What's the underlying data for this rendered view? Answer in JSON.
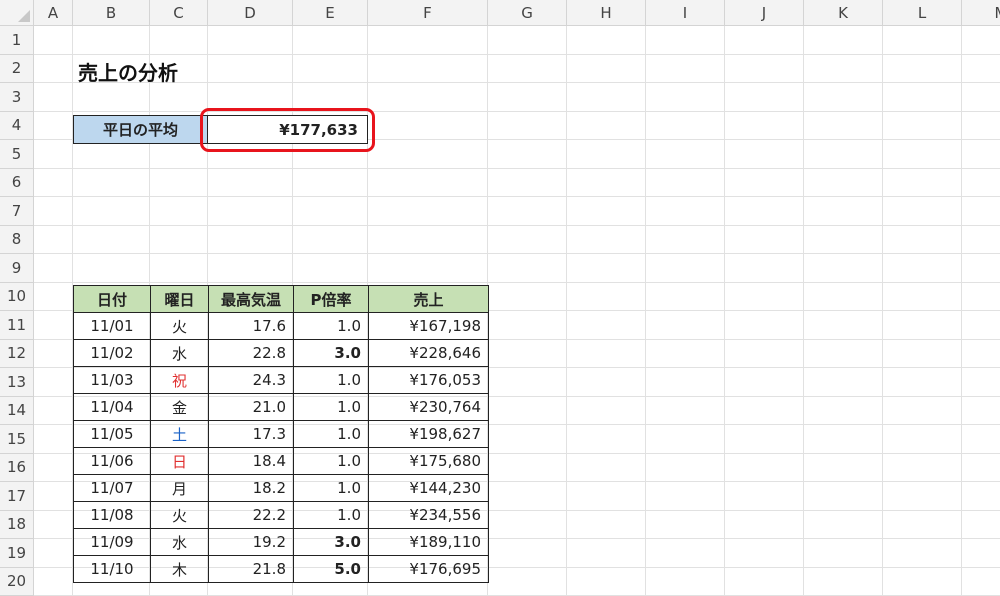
{
  "columns": [
    "A",
    "B",
    "C",
    "D",
    "E",
    "F",
    "G",
    "H",
    "I",
    "J",
    "K",
    "L",
    "M"
  ],
  "rows": [
    "1",
    "2",
    "3",
    "4",
    "5",
    "6",
    "7",
    "8",
    "9",
    "10",
    "11",
    "12",
    "13",
    "14",
    "15",
    "16",
    "17",
    "18",
    "19",
    "20"
  ],
  "sheet_title": "売上の分析",
  "summary": {
    "label": "平日の平均",
    "value": "¥177,633"
  },
  "colors": {
    "header_fill": "#c6e0b4",
    "label_fill": "#bdd7ee",
    "highlight": "#e8141c",
    "holiday": "#e03030",
    "saturday": "#1a62c7"
  },
  "table": {
    "headers": [
      "日付",
      "曜日",
      "最高気温",
      "P倍率",
      "売上"
    ],
    "rows": [
      {
        "date": "11/01",
        "day": "火",
        "temp": "17.6",
        "rate": "1.0",
        "sales": "¥167,198",
        "day_color": "",
        "rate_bold": false
      },
      {
        "date": "11/02",
        "day": "水",
        "temp": "22.8",
        "rate": "3.0",
        "sales": "¥228,646",
        "day_color": "",
        "rate_bold": true
      },
      {
        "date": "11/03",
        "day": "祝",
        "temp": "24.3",
        "rate": "1.0",
        "sales": "¥176,053",
        "day_color": "red",
        "rate_bold": false
      },
      {
        "date": "11/04",
        "day": "金",
        "temp": "21.0",
        "rate": "1.0",
        "sales": "¥230,764",
        "day_color": "",
        "rate_bold": false
      },
      {
        "date": "11/05",
        "day": "土",
        "temp": "17.3",
        "rate": "1.0",
        "sales": "¥198,627",
        "day_color": "blue",
        "rate_bold": false
      },
      {
        "date": "11/06",
        "day": "日",
        "temp": "18.4",
        "rate": "1.0",
        "sales": "¥175,680",
        "day_color": "red",
        "rate_bold": false
      },
      {
        "date": "11/07",
        "day": "月",
        "temp": "18.2",
        "rate": "1.0",
        "sales": "¥144,230",
        "day_color": "",
        "rate_bold": false
      },
      {
        "date": "11/08",
        "day": "火",
        "temp": "22.2",
        "rate": "1.0",
        "sales": "¥234,556",
        "day_color": "",
        "rate_bold": false
      },
      {
        "date": "11/09",
        "day": "水",
        "temp": "19.2",
        "rate": "3.0",
        "sales": "¥189,110",
        "day_color": "",
        "rate_bold": true
      },
      {
        "date": "11/10",
        "day": "木",
        "temp": "21.8",
        "rate": "5.0",
        "sales": "¥176,695",
        "day_color": "",
        "rate_bold": true
      }
    ]
  }
}
